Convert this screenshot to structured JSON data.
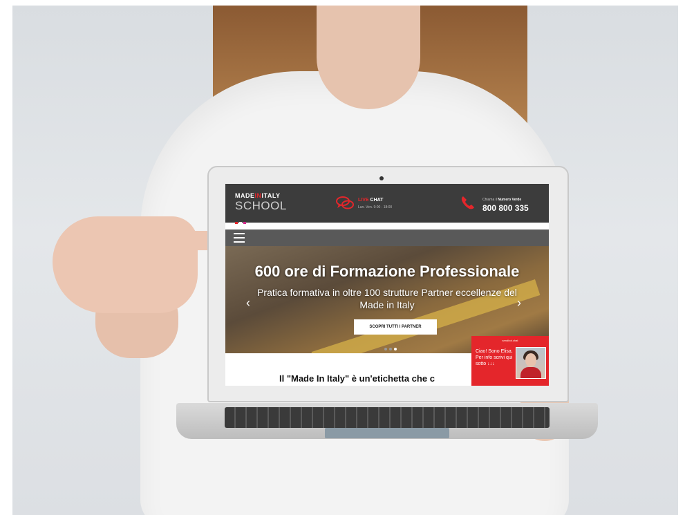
{
  "site": {
    "logo_top_a": "MADE",
    "logo_top_in": "IN",
    "logo_top_b": "ITALY",
    "logo_bottom": "SCHOOL",
    "logo_dot_colors": [
      "#e4262b",
      "#ffffff",
      "#d12a8a"
    ]
  },
  "live_chat": {
    "label_red": "LIVE",
    "label": "CHAT",
    "hours": "Lun. Ven. 9:00 - 18:00",
    "icon": "chat-bubbles-icon"
  },
  "call": {
    "label_prefix": "Chiama il",
    "label_bold": "Numero Verde",
    "number": "800 800 335",
    "icon": "phone-icon"
  },
  "nav": {
    "menu_icon": "hamburger-menu-icon"
  },
  "hero": {
    "title": "600 ore di Formazione Professionale",
    "subtitle": "Pratica formativa in oltre 100 strutture Partner eccellenze del Made in Italy",
    "cta": "SCOPRI TUTTI I PARTNER",
    "prev_arrow": "‹",
    "next_arrow": "›",
    "slide_count": 3,
    "active_slide": 3
  },
  "content": {
    "heading": "Il \"Made In Italy\" è un'etichetta che c"
  },
  "chat_widget": {
    "brand": "sendbot.chat",
    "message": "Ciao! Sono Elisa. Per info scrivi qui sotto ↓↓↓"
  },
  "colors": {
    "accent": "#e4262b",
    "header_bg": "#3c3c3c",
    "navbar_bg": "#595959"
  }
}
